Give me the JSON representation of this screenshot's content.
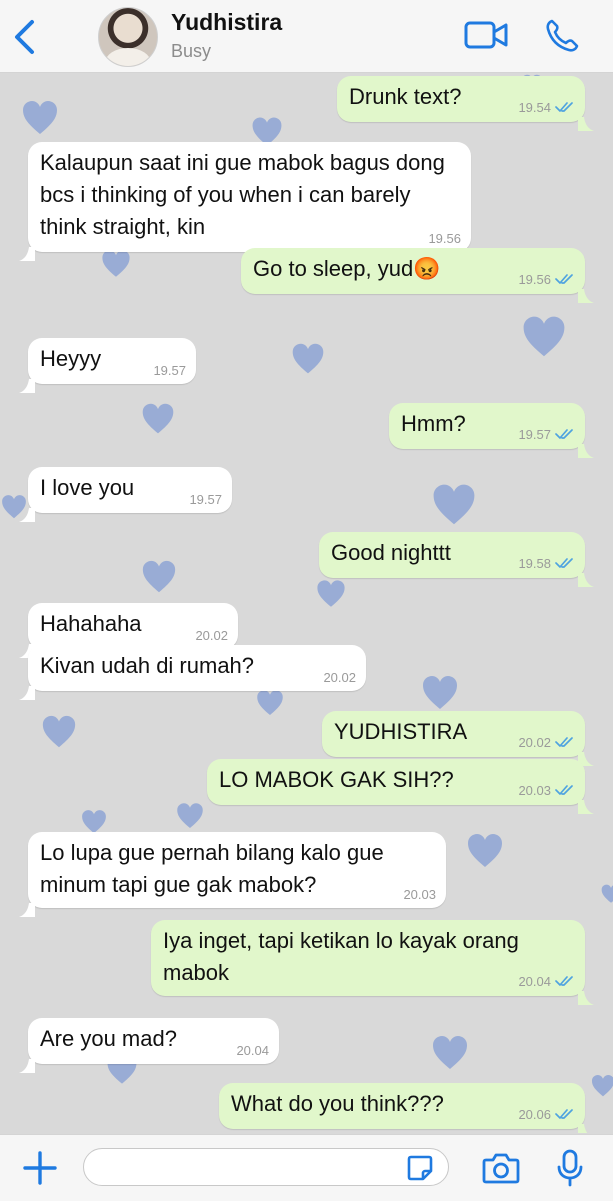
{
  "header": {
    "back_icon": "chevron-left-icon",
    "contact_name": "Yudhistira",
    "contact_status": "Busy",
    "video_icon": "video-camera-icon",
    "call_icon": "phone-icon",
    "accent": "#1f7ae0"
  },
  "messages": [
    {
      "dir": "out",
      "text": "Drunk text?",
      "time": "19.54",
      "read": true
    },
    {
      "dir": "in",
      "text": "Kalaupun saat ini gue mabok bagus dong bcs i thinking of you when i can barely think straight, kin",
      "time": "19.56"
    },
    {
      "dir": "out",
      "text": "Go to sleep, yud😡",
      "time": "19.56",
      "read": true
    },
    {
      "dir": "in",
      "text": "Heyyy",
      "time": "19.57"
    },
    {
      "dir": "out",
      "text": "Hmm?",
      "time": "19.57",
      "read": true
    },
    {
      "dir": "in",
      "text": "I love you",
      "time": "19.57"
    },
    {
      "dir": "out",
      "text": "Good nighttt",
      "time": "19.58",
      "read": true
    },
    {
      "dir": "in",
      "text": "Hahahaha",
      "time": "20.02"
    },
    {
      "dir": "in",
      "text": "Kivan udah di rumah?",
      "time": "20.02"
    },
    {
      "dir": "out",
      "text": "YUDHISTIRA",
      "time": "20.02",
      "read": true
    },
    {
      "dir": "out",
      "text": "LO MABOK GAK SIH??",
      "time": "20.03",
      "read": true
    },
    {
      "dir": "in",
      "text": "Lo lupa gue pernah bilang kalo gue minum tapi gue gak mabok?",
      "time": "20.03"
    },
    {
      "dir": "out",
      "text": "Iya inget, tapi ketikan lo kayak orang mabok",
      "time": "20.04",
      "read": true
    },
    {
      "dir": "in",
      "text": "Are you mad?",
      "time": "20.04"
    },
    {
      "dir": "out",
      "text": "What do you think???",
      "time": "20.06",
      "read": true
    }
  ],
  "footer": {
    "add_icon": "plus-icon",
    "input_value": "",
    "sticker_icon": "sticker-icon",
    "camera_icon": "camera-icon",
    "mic_icon": "microphone-icon"
  },
  "colors": {
    "incoming_bubble": "#ffffff",
    "outgoing_bubble": "#e1f7cb",
    "read_ticks": "#4fa3e0",
    "wallpaper": "#d9d9d9",
    "wallpaper_hearts": "#6f8fd1"
  }
}
